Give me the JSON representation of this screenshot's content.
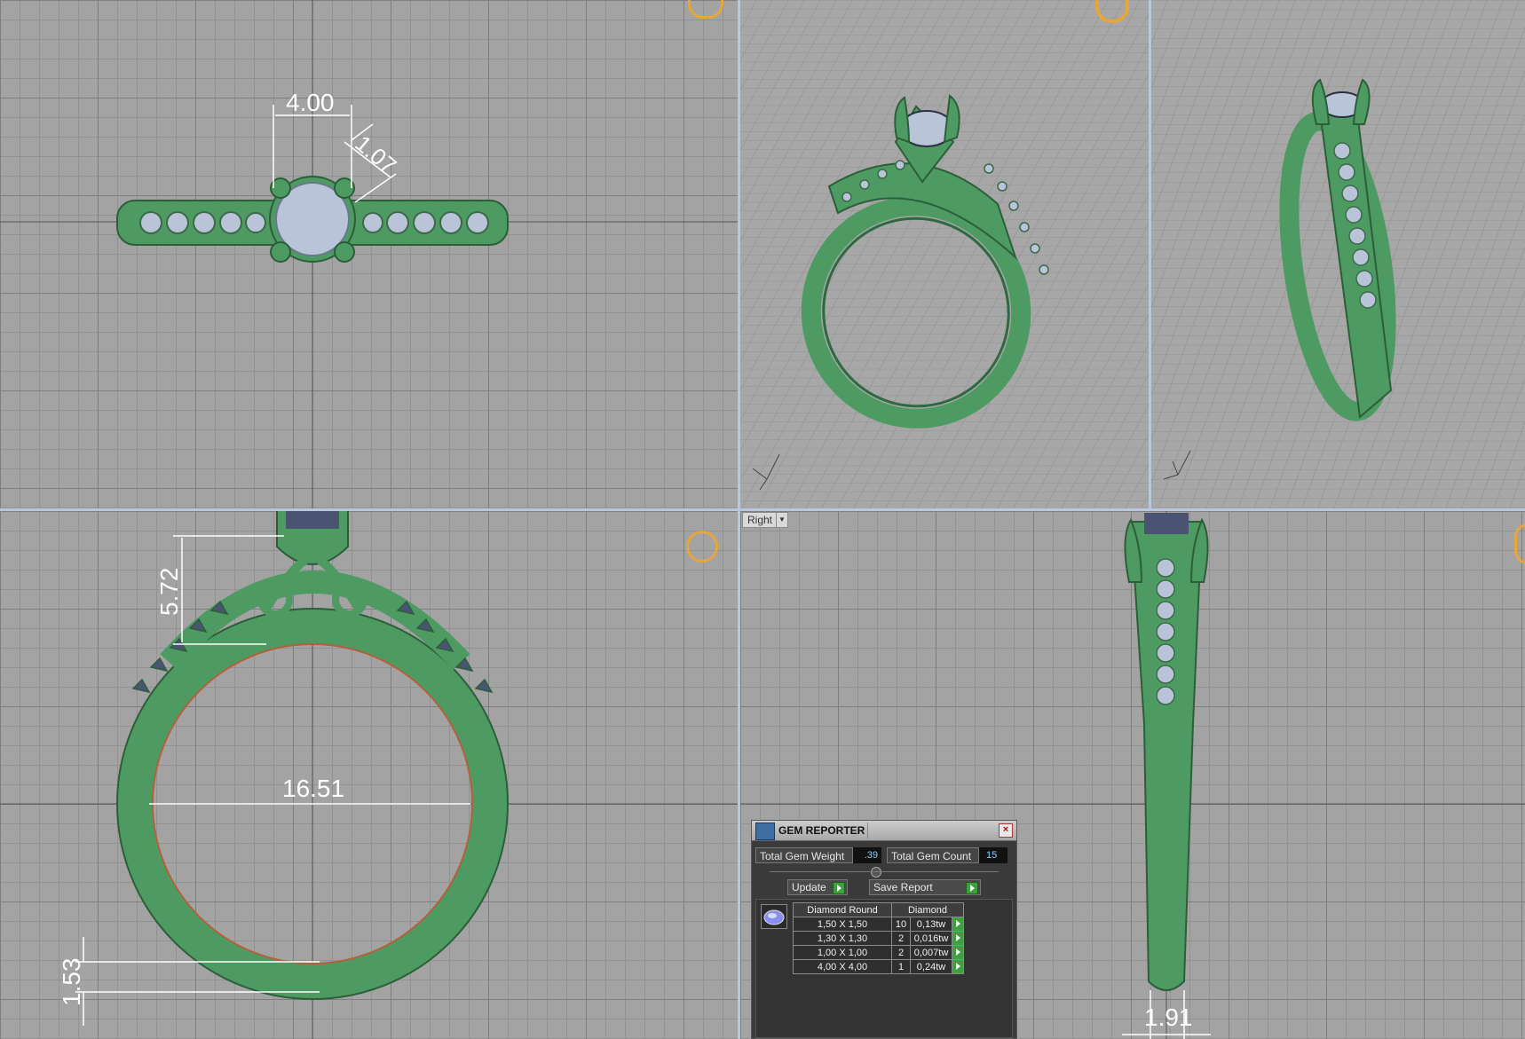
{
  "viewports": {
    "top": {
      "dims": [
        "4.00",
        "1.07"
      ]
    },
    "front": {
      "dims": [
        "5.72",
        "16.51",
        "1.53"
      ]
    },
    "right": {
      "view_label": "Right",
      "dims": [
        "1.91"
      ]
    }
  },
  "gem_reporter": {
    "title": "GEM REPORTER",
    "total_gem_weight_label": "Total Gem Weight",
    "total_gem_weight_value": ".39",
    "total_gem_count_label": "Total Gem Count",
    "total_gem_count_value": "15",
    "update_label": "Update",
    "save_report_label": "Save Report",
    "table": {
      "headers": [
        "Diamond Round",
        "Diamond"
      ],
      "rows": [
        {
          "size": "1,50 X 1,50",
          "count": "10",
          "weight": "0,13tw"
        },
        {
          "size": "1,30 X 1,30",
          "count": "2",
          "weight": "0,016tw"
        },
        {
          "size": "1,00 X 1,00",
          "count": "2",
          "weight": "0,007tw"
        },
        {
          "size": "4,00 X 4,00",
          "count": "1",
          "weight": "0,24tw"
        }
      ]
    }
  },
  "colors": {
    "metal": "#4e9a63",
    "gem": "#b9c4d8",
    "grid": "#a3a3a3",
    "border": "#b9c6e2"
  }
}
